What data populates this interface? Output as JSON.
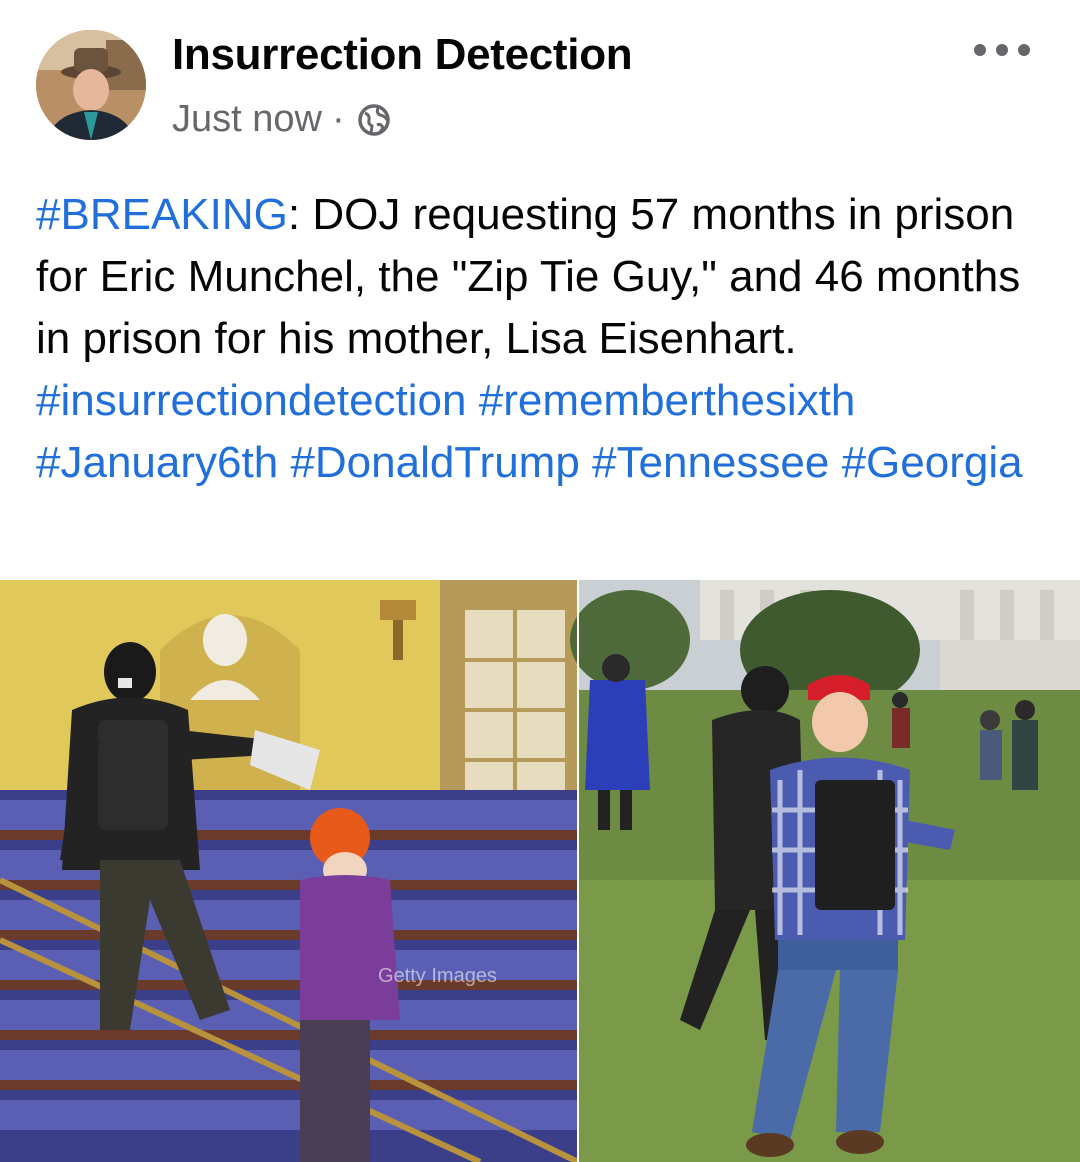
{
  "post": {
    "author": "Insurrection Detection",
    "timestamp": "Just now",
    "separator": "·",
    "audience_icon": "globe-icon",
    "more_icon": "more-options-icon",
    "text_parts": {
      "tag_breaking": "#BREAKING",
      "body": ": DOJ requesting 57 months in prison for Eric Munchel, the \"Zip Tie Guy,\" and 46 months in prison for his mother, Lisa Eisenhart. ",
      "hashtags": [
        "#insurrectiondetection",
        "#rememberthesixth",
        "#January6th",
        "#DonaldTrump",
        "#Tennessee",
        "#Georgia"
      ]
    },
    "image": {
      "watermark": "Getty Images"
    }
  },
  "colors": {
    "link": "#216fdb",
    "secondary_text": "#65676b",
    "primary_text": "#050505"
  }
}
